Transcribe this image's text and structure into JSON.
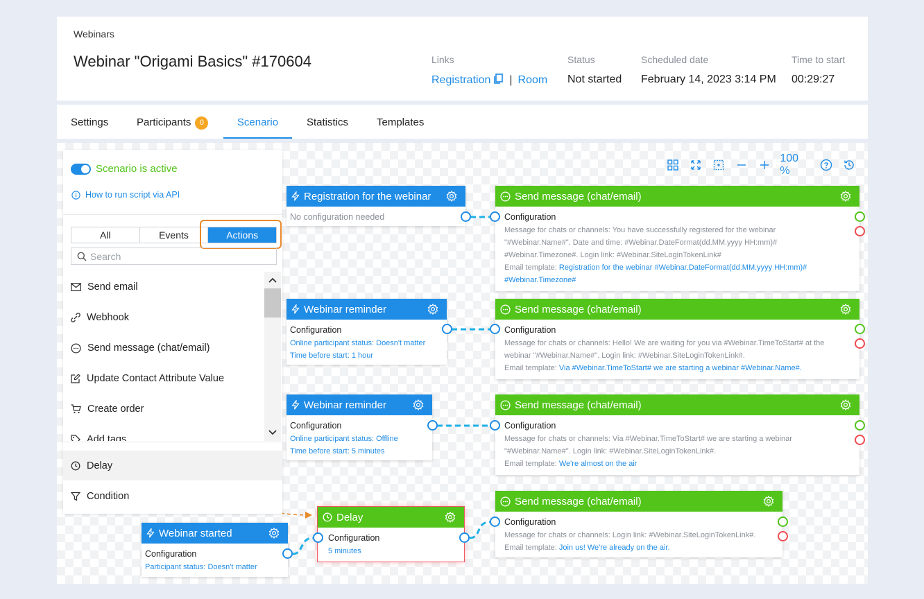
{
  "header": {
    "breadcrumb": "Webinars",
    "title": "Webinar \"Origami Basics\" #170604",
    "links_label": "Links",
    "registration_link": "Registration",
    "room_link": "Room",
    "status_label": "Status",
    "status_value": "Not started",
    "scheduled_label": "Scheduled date",
    "scheduled_value": "February 14, 2023 3:14 PM",
    "time_label": "Time to start",
    "time_value": "00:29:27"
  },
  "tabs": [
    {
      "label": "Settings"
    },
    {
      "label": "Participants",
      "badge": "0"
    },
    {
      "label": "Scenario",
      "active": true
    },
    {
      "label": "Statistics"
    },
    {
      "label": "Templates"
    }
  ],
  "toolbar": {
    "zoom": "100 %"
  },
  "panel": {
    "active_label": "Scenario is active",
    "api_link": "How to run script via API",
    "filters": [
      "All",
      "Events",
      "Actions"
    ],
    "search_placeholder": "Search",
    "actions": [
      "Send email",
      "Webhook",
      "Send message (chat/email)",
      "Update Contact Attribute Value",
      "Create order",
      "Add tags"
    ],
    "delay": "Delay",
    "condition": "Condition"
  },
  "nodes": {
    "registration": {
      "title": "Registration for the webinar",
      "body": "No configuration needed"
    },
    "reminder1": {
      "title": "Webinar reminder",
      "config": "Configuration",
      "line1": "Online participant status: Doesn't matter",
      "line2": "Time before start: 1 hour"
    },
    "reminder2": {
      "title": "Webinar reminder",
      "config": "Configuration",
      "line1": "Online participant status: Offline",
      "line2": "Time before start: 5 minutes"
    },
    "started": {
      "title": "Webinar started",
      "config": "Configuration",
      "line1": "Participant status: Doesn't matter"
    },
    "delay": {
      "title": "Delay",
      "config": "Configuration",
      "line1": "5 minutes"
    },
    "msg1": {
      "title": "Send message (chat/email)",
      "config": "Configuration",
      "line1": "Message for chats or channels: You have successfully registered for the webinar",
      "line2": "\"#Webinar.Name#\". Date and time: #Webinar.DateFormat(dd.MM.yyyy HH:mm)#",
      "line3": "#Webinar.Timezone#. Login link: #Webinar.SiteLoginTokenLink#",
      "template_label": "Email template: ",
      "template_a": "Registration for the webinar #Webinar.DateFormat(dd.MM.yyyy HH:mm)#",
      "template_b": "#Webinar.Timezone#"
    },
    "msg2": {
      "title": "Send message (chat/email)",
      "config": "Configuration",
      "line1": "Message for chats or channels: Hello! We are waiting for you via #Webinar.TimeToStart# at the",
      "line2": "webinar \"#Webinar.Name#\". Login link: #Webinar.SiteLoginTokenLink#.",
      "template_label": "Email template: ",
      "template": "Via #Webinar.TimeToStart# we are starting a webinar #Webinar.Name#."
    },
    "msg3": {
      "title": "Send message (chat/email)",
      "config": "Configuration",
      "line1": "Message for chats or channels: Via #Webinar.TimeToStart# we are starting a webinar",
      "line2": "\"#Webinar.Name#\". Login link: #Webinar.SiteLoginTokenLink#.",
      "template_label": "Email template: ",
      "template": "We're almost on the air"
    },
    "msg4": {
      "title": "Send message (chat/email)",
      "config": "Configuration",
      "line1": "Message for chats or channels: Login link: #Webinar.SiteLoginTokenLink#.",
      "template_label": "Email template: ",
      "template": "Join us! We're already on the air."
    }
  },
  "colors": {
    "accent": "#1f8ce6",
    "green": "#52c41a",
    "error": "#ef4b52",
    "highlight": "#e8892a"
  }
}
